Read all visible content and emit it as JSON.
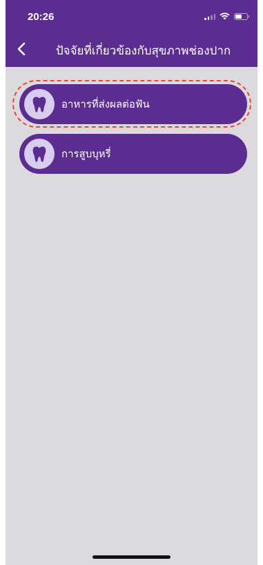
{
  "status_bar": {
    "time": "20:26"
  },
  "header": {
    "title": "ปัจจัยที่เกี่ยวข้องกับสุขภาพช่องปาก",
    "back_icon": "chevron-left-icon"
  },
  "menu": {
    "items": [
      {
        "label": "อาหารที่ส่งผลต่อฟัน",
        "icon": "tooth-icon",
        "highlighted": true
      },
      {
        "label": "การสูบบุหรี่",
        "icon": "tooth-icon",
        "highlighted": false
      }
    ]
  },
  "colors": {
    "primary": "#5c2d91",
    "background": "#dcd9df",
    "icon_circle": "#d9cdef",
    "highlight_ring": "#e8442e"
  }
}
